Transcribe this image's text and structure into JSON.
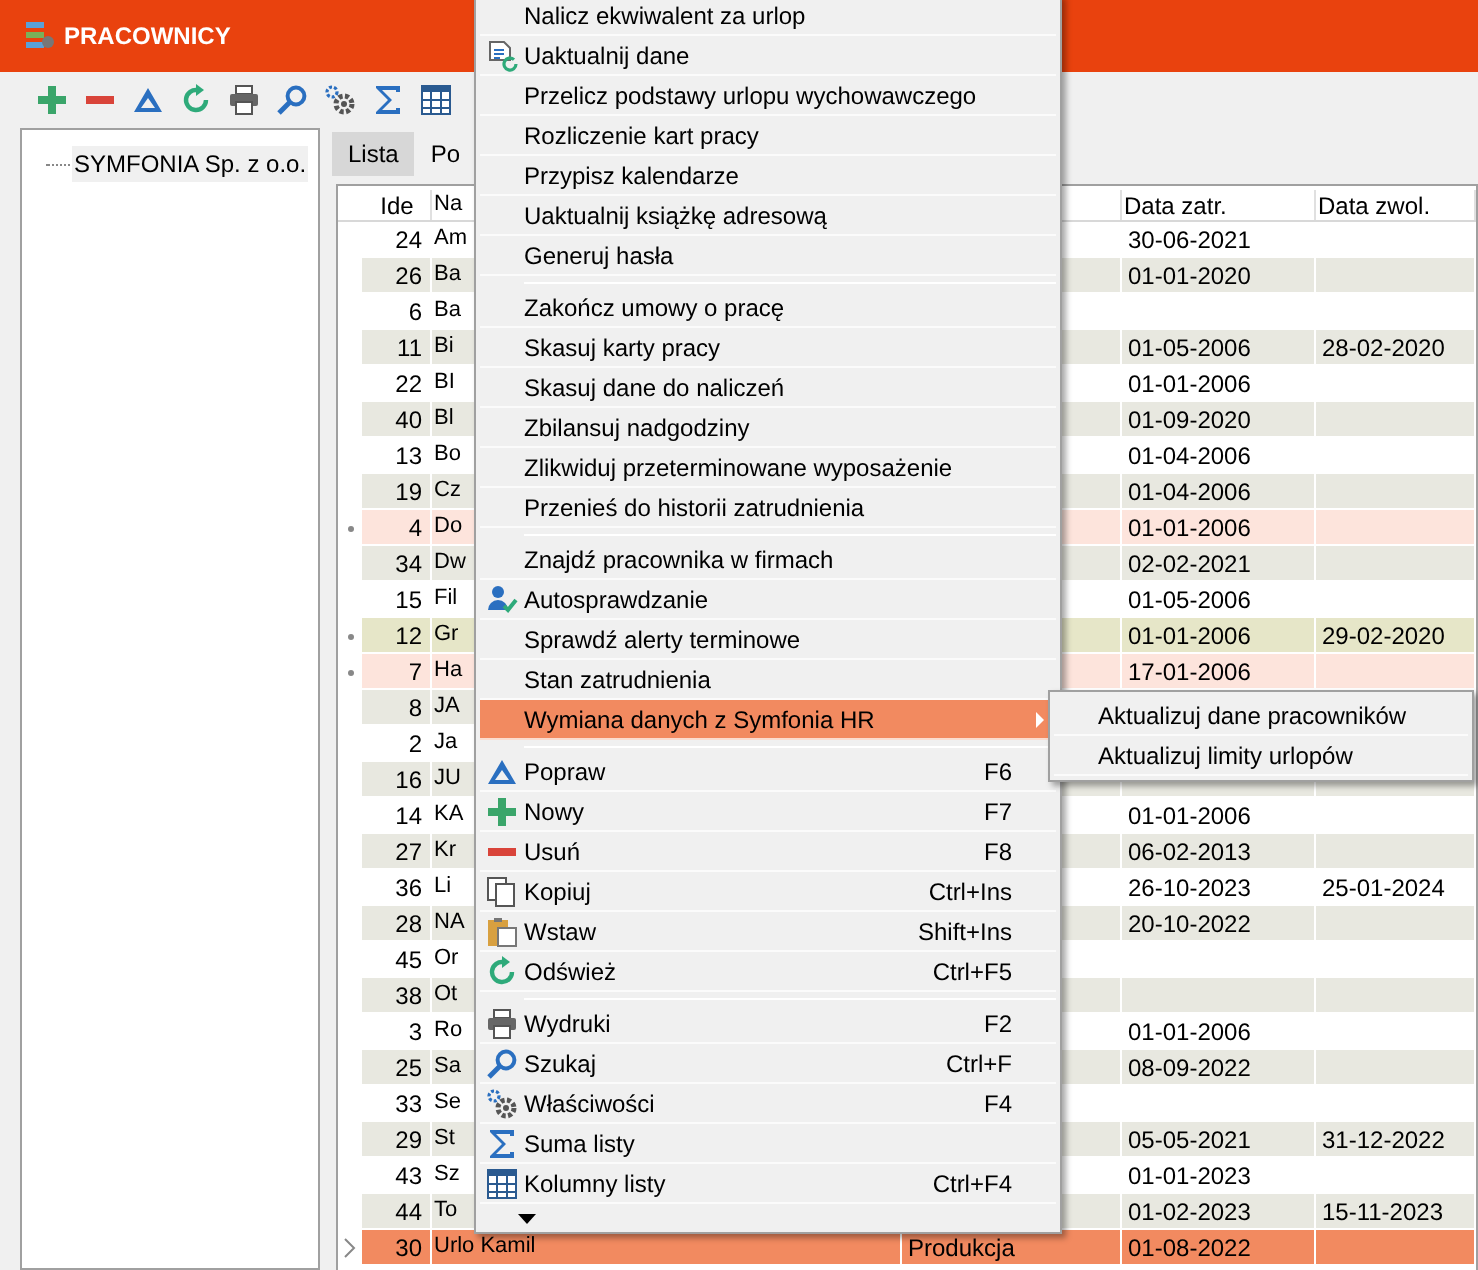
{
  "window": {
    "title": "PRACOWNICY"
  },
  "tree": {
    "items": [
      {
        "label": "SYMFONIA Sp. z o.o.",
        "selected": true
      }
    ]
  },
  "tabs": [
    {
      "label": "Lista",
      "selected": true
    },
    {
      "label": "Po",
      "selected": false
    }
  ],
  "table": {
    "columns": [
      "Ide",
      "Na",
      "Data zatr.",
      "Data zwol."
    ],
    "rows": [
      {
        "id": "24",
        "name": "Am",
        "hired": "30-06-2021"
      },
      {
        "id": "26",
        "name": "Ba",
        "hired": "01-01-2020"
      },
      {
        "id": "6",
        "name": "Ba"
      },
      {
        "id": "11",
        "name": "Bi",
        "hired": "01-05-2006",
        "left": "28-02-2020"
      },
      {
        "id": "22",
        "name": "BI",
        "hired": "01-01-2006"
      },
      {
        "id": "40",
        "name": "Bl",
        "hired": "01-09-2020"
      },
      {
        "id": "13",
        "name": "Bo",
        "hired": "01-04-2006"
      },
      {
        "id": "19",
        "name": "Cz",
        "hired": "01-04-2006"
      },
      {
        "id": "4",
        "name": "Do",
        "hired": "01-01-2006",
        "marked": true,
        "color": "#fde4dc"
      },
      {
        "id": "34",
        "name": "Dw",
        "hired": "02-02-2021"
      },
      {
        "id": "15",
        "name": "Fil",
        "hired": "01-05-2006"
      },
      {
        "id": "12",
        "name": "Gr",
        "hired": "01-01-2006",
        "left": "29-02-2020",
        "marked": true,
        "color": "#e6e6c8"
      },
      {
        "id": "7",
        "name": "Ha",
        "hired": "17-01-2006",
        "marked": true,
        "color": "#fde4dc"
      },
      {
        "id": "8",
        "name": "JA"
      },
      {
        "id": "2",
        "name": "Ja"
      },
      {
        "id": "16",
        "name": "JU"
      },
      {
        "id": "14",
        "name": "KA",
        "hired": "01-01-2006"
      },
      {
        "id": "27",
        "name": "Kr",
        "hired": "06-02-2013"
      },
      {
        "id": "36",
        "name": "Li",
        "hired": "26-10-2023",
        "left": "25-01-2024"
      },
      {
        "id": "28",
        "name": "NA",
        "hired": "20-10-2022"
      },
      {
        "id": "45",
        "name": "Or"
      },
      {
        "id": "38",
        "name": "Ot"
      },
      {
        "id": "3",
        "name": "Ro",
        "hired": "01-01-2006"
      },
      {
        "id": "25",
        "name": "Sa",
        "hired": "08-09-2022"
      },
      {
        "id": "33",
        "name": "Se"
      },
      {
        "id": "29",
        "name": "St",
        "hired": "05-05-2021",
        "left": "31-12-2022"
      },
      {
        "id": "43",
        "name": "Sz",
        "hired": "01-01-2023"
      },
      {
        "id": "44",
        "name": "To",
        "hired": "01-02-2023",
        "left": "15-11-2023"
      },
      {
        "id": "30",
        "name": "Urlo Kamil",
        "dept": "Produkcja",
        "hired": "01-08-2022",
        "selected": true
      }
    ]
  },
  "context_menu": {
    "items": [
      {
        "kind": "item",
        "label": "Nalicz ekwiwalent za urlop"
      },
      {
        "kind": "item",
        "label": "Uaktualnij dane"
      },
      {
        "kind": "item",
        "label": "Przelicz podstawy urlopu wychowawczego"
      },
      {
        "kind": "item",
        "label": "Rozliczenie kart pracy"
      },
      {
        "kind": "item",
        "label": "Przypisz kalendarze"
      },
      {
        "kind": "item",
        "label": "Uaktualnij książkę adresową"
      },
      {
        "kind": "item",
        "label": "Generuj hasła"
      },
      {
        "kind": "separator"
      },
      {
        "kind": "item",
        "label": "Zakończ umowy o pracę"
      },
      {
        "kind": "item",
        "label": "Skasuj karty pracy"
      },
      {
        "kind": "item",
        "label": "Skasuj dane do naliczeń"
      },
      {
        "kind": "item",
        "label": "Zbilansuj nadgodziny"
      },
      {
        "kind": "item",
        "label": "Zlikwiduj przeterminowane wyposażenie"
      },
      {
        "kind": "item",
        "label": "Przenieś do historii zatrudnienia"
      },
      {
        "kind": "separator"
      },
      {
        "kind": "item",
        "label": "Znajdź pracownika w firmach"
      },
      {
        "kind": "item",
        "label": "Autosprawdzanie"
      },
      {
        "kind": "item",
        "label": "Sprawdź alerty terminowe"
      },
      {
        "kind": "item",
        "label": "Stan zatrudnienia"
      },
      {
        "kind": "submenu",
        "label": "Wymiana danych z Symfonia HR",
        "selected": true
      },
      {
        "kind": "separator"
      },
      {
        "kind": "item",
        "label": "Popraw",
        "shortcut": "F6"
      },
      {
        "kind": "item",
        "label": "Nowy",
        "shortcut": "F7"
      },
      {
        "kind": "item",
        "label": "Usuń",
        "shortcut": "F8"
      },
      {
        "kind": "item",
        "label": "Kopiuj",
        "shortcut": "Ctrl+Ins"
      },
      {
        "kind": "item",
        "label": "Wstaw",
        "shortcut": "Shift+Ins"
      },
      {
        "kind": "item",
        "label": "Odśwież",
        "shortcut": "Ctrl+F5"
      },
      {
        "kind": "separator"
      },
      {
        "kind": "item",
        "label": "Wydruki",
        "shortcut": "F2"
      },
      {
        "kind": "item",
        "label": "Szukaj",
        "shortcut": "Ctrl+F"
      },
      {
        "kind": "item",
        "label": "Właściwości",
        "shortcut": "F4"
      },
      {
        "kind": "item",
        "label": "Suma listy"
      },
      {
        "kind": "item",
        "label": "Kolumny listy",
        "shortcut": "Ctrl+F4"
      },
      {
        "kind": "more"
      }
    ]
  },
  "submenu": {
    "items": [
      {
        "label": "Aktualizuj dane pracowników"
      },
      {
        "label": "Aktualizuj limity urlopów"
      }
    ]
  }
}
